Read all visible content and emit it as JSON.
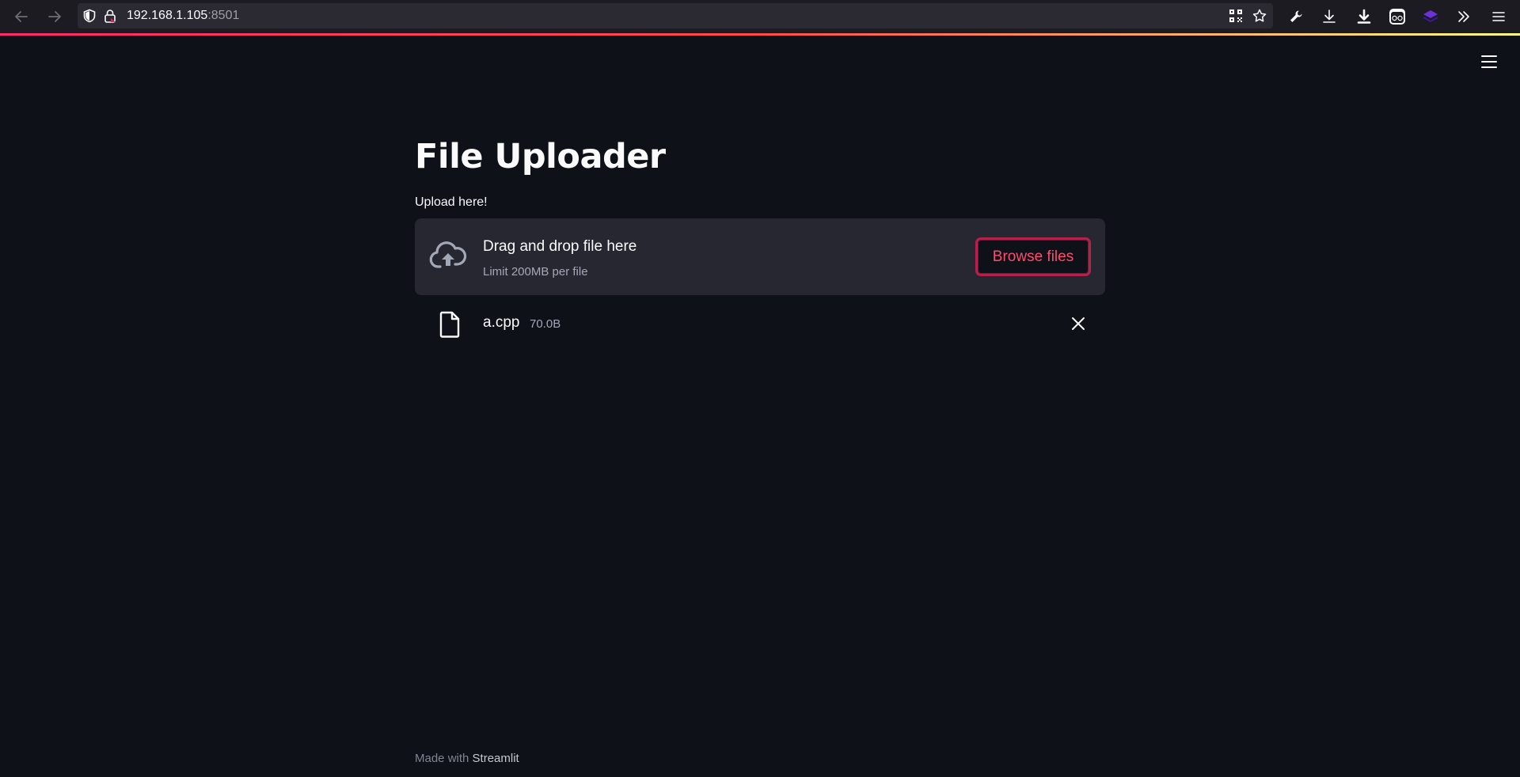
{
  "browser": {
    "url_host": "192.168.1.105",
    "url_port": ":8501"
  },
  "app": {
    "title": "File Uploader",
    "uploader_label": "Upload here!",
    "dropzone": {
      "instruction": "Drag and drop file here",
      "limit": "Limit 200MB per file",
      "browse_label": "Browse files"
    },
    "files": [
      {
        "name": "a.cpp",
        "size": "70.0B"
      }
    ],
    "footer": {
      "made_with": "Made with",
      "brand": "Streamlit"
    }
  },
  "colors": {
    "background": "#0e1117",
    "dropzone_bg": "#262730",
    "accent": "#ff4b4b",
    "browser_toolbar": "#1c1b22"
  },
  "icons": {
    "back": "arrow-left-icon",
    "forward": "arrow-right-icon",
    "shield": "shield-icon",
    "lock": "lock-icon",
    "qr": "qr-code-icon",
    "bookmark": "star-icon",
    "tools": "wrench-icon",
    "download": "download-icon",
    "download_alt": "download-bold-icon",
    "extension": "extension-icon",
    "layers": "layers-icon",
    "overflow": "chevrons-right-icon",
    "menu": "hamburger-icon",
    "upload": "cloud-upload-icon",
    "file": "file-icon",
    "close": "close-icon"
  }
}
